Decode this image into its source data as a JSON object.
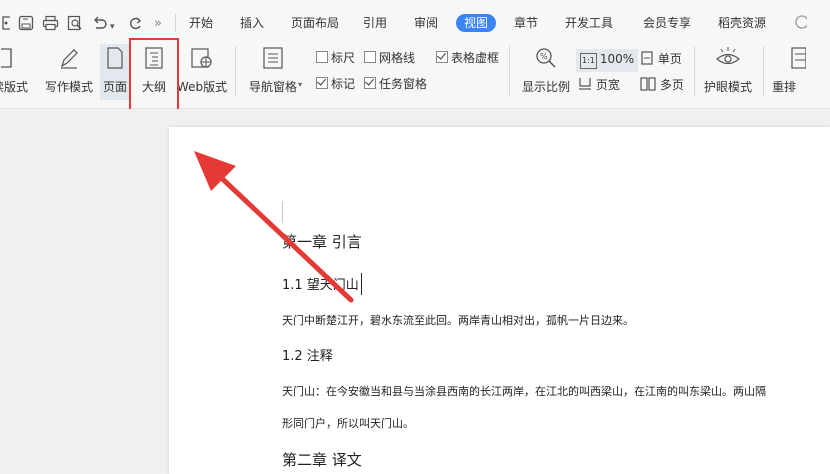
{
  "quick_access": {
    "icons": [
      "toolbar-icon",
      "save-icon",
      "print-icon",
      "print-preview-icon",
      "undo-icon",
      "redo-icon"
    ],
    "dropdown": "▾",
    "more": "»"
  },
  "menu": {
    "tabs": [
      "开始",
      "插入",
      "页面布局",
      "引用",
      "审阅",
      "视图",
      "章节",
      "开发工具",
      "会员专享",
      "稻壳资源"
    ],
    "active": "视图"
  },
  "ribbon": {
    "read_mode": "读版式",
    "write_mode": "写作模式",
    "page": "页面",
    "outline": "大纲",
    "web": "Web版式",
    "nav_pane": "导航窗格",
    "ruler": "标尺",
    "gridlines": "网格线",
    "table_gridlines": "表格虚框",
    "marks": "标记",
    "task_pane": "任务窗格",
    "zoom": "显示比例",
    "zoom_value": "100%",
    "zoom_icon_text": "1:1",
    "page_width": "页宽",
    "single_page": "单页",
    "multi_page": "多页",
    "eye_care": "护眼模式",
    "rearrange": "重排"
  },
  "checkboxes": {
    "ruler": false,
    "gridlines": false,
    "table_gridlines": true,
    "marks": true,
    "task_pane": true
  },
  "document": {
    "chapter1": "第一章 引言",
    "sec1_1": "1.1 望天门山",
    "poem": "天门中断楚江开，碧水东流至此回。两岸青山相对出，孤帆一片日边来。",
    "sec1_2": "1.2 注释",
    "note_line1": "天门山：在今安徽当和县与当涂县西南的长江两岸，在江北的叫西梁山，在江南的叫东梁山。两山隔",
    "note_line2": "形同门户，所以叫天门山。",
    "chapter2": "第二章 译文"
  },
  "colors": {
    "accent": "#3a84f6",
    "highlight": "#e53935",
    "arrow": "#e53935"
  }
}
